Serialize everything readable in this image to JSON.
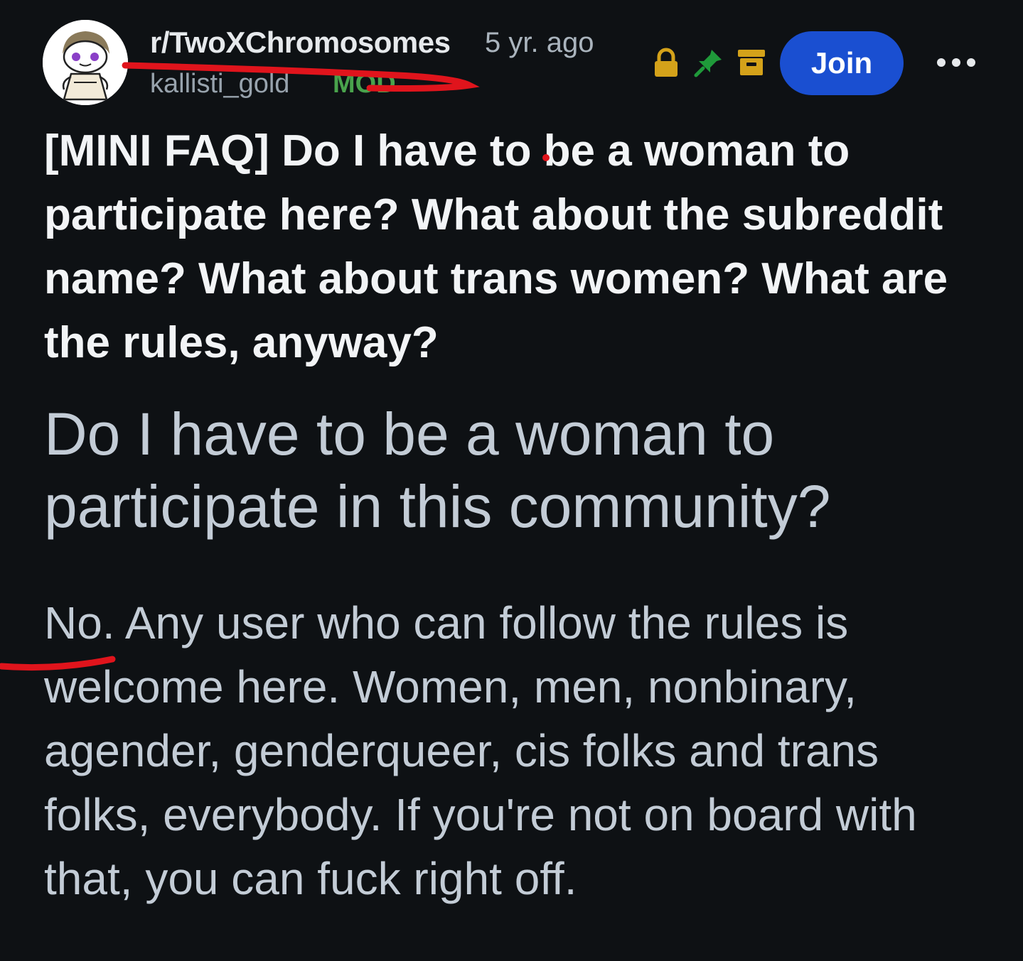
{
  "post": {
    "subreddit": "r/TwoXChromosomes",
    "age": "5 yr. ago",
    "author": "kallisti_gold",
    "author_badge": "MOD",
    "join_label": "Join",
    "title": "[MINI FAQ] Do I have to be a woman to participate here? What about the subreddit name? What about trans women? What are the rules, anyway?",
    "heading": "Do I have to be a woman to participate in this community?",
    "body": "No. Any user who can follow the rules is welcome here. Women, men, nonbinary, agender, genderqueer, cis folks and trans folks, everybody. If you're not on board with that, you can fuck right off."
  },
  "icons": {
    "lock": "lock-icon",
    "pin": "pin-icon",
    "archive": "archive-icon",
    "more": "more-options-icon"
  },
  "colors": {
    "background": "#0e1114",
    "join_button": "#1a4fd1",
    "lock": "#d4a21a",
    "pin": "#1f9a3a",
    "archive": "#d4a21a",
    "mod_badge": "#49a34c",
    "annotation_marker": "#e0141c"
  }
}
